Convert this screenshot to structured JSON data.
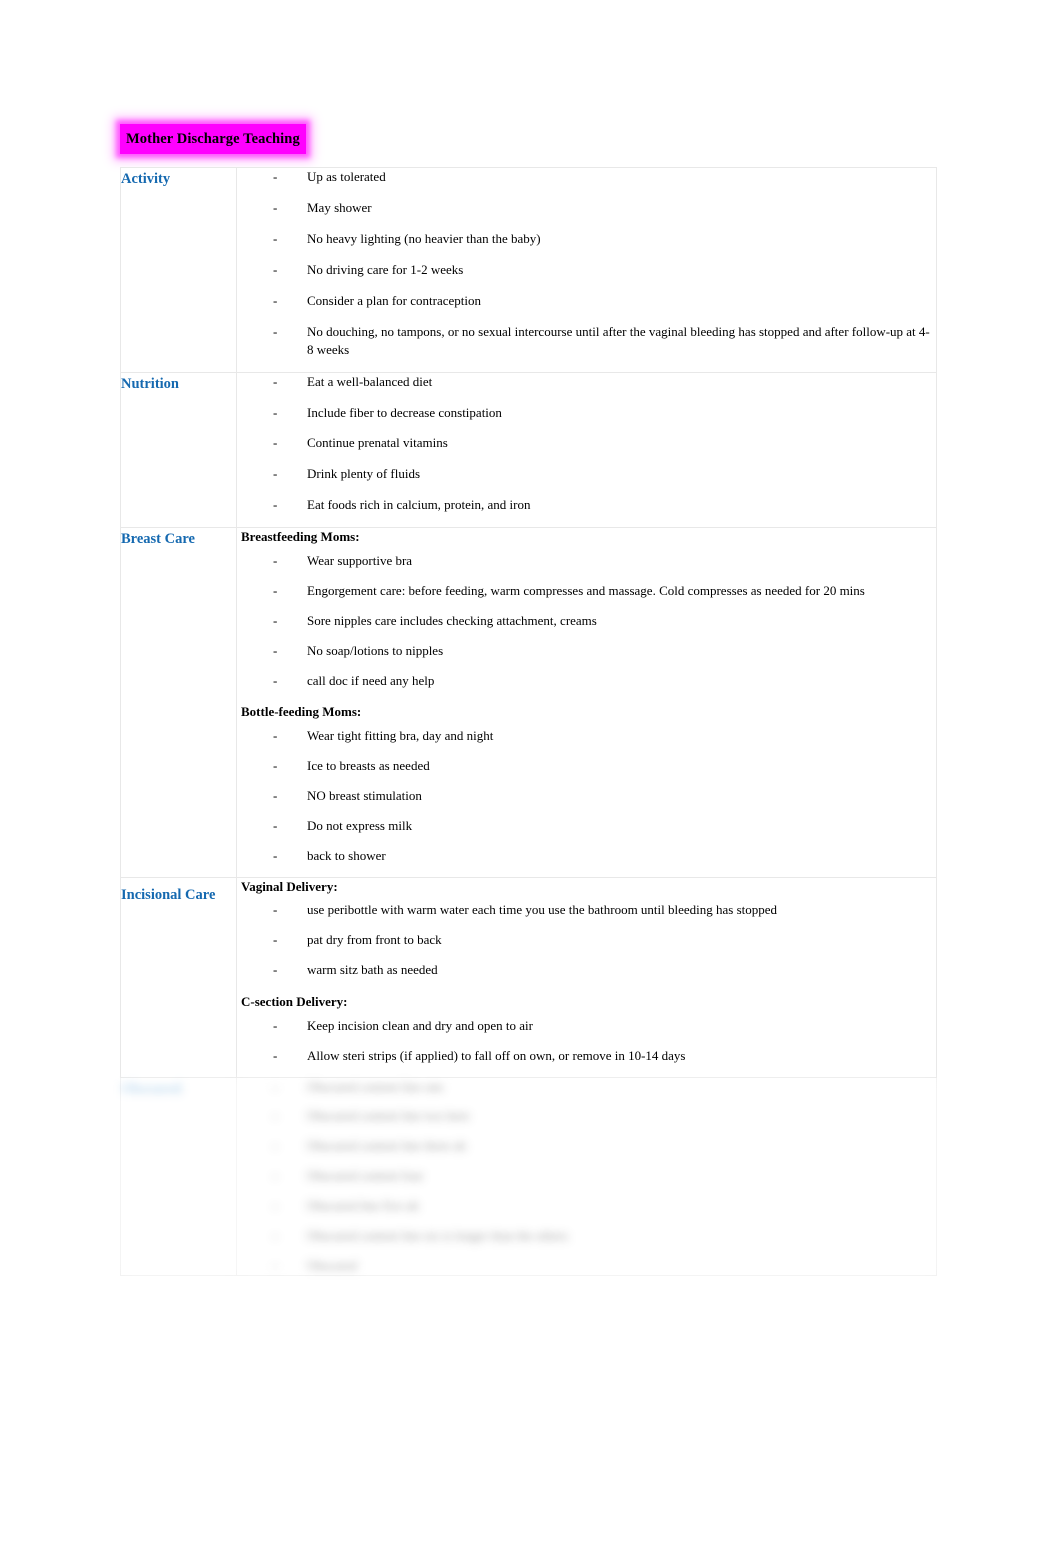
{
  "document": {
    "title": "Mother Discharge Teaching",
    "title_highlight_color": "#ff00ff",
    "heading_color": "#1569b0",
    "body_text_color": "#000000",
    "bullet_marker": "-"
  },
  "table": {
    "rows": [
      {
        "label": "Activity",
        "groups": [
          {
            "subhead": null,
            "items": [
              "Up as tolerated",
              "May shower",
              "No heavy lighting (no heavier than the baby)",
              "No driving care for 1-2 weeks",
              "Consider a plan for contraception",
              "No douching, no tampons, or no sexual intercourse until after the vaginal bleeding has stopped and after follow-up at 4-8 weeks"
            ]
          }
        ]
      },
      {
        "label": "Nutrition",
        "groups": [
          {
            "subhead": null,
            "items": [
              "Eat a well-balanced diet",
              "Include fiber to decrease constipation",
              "Continue prenatal vitamins",
              "Drink plenty of fluids",
              "Eat foods rich in calcium, protein, and iron"
            ]
          }
        ]
      },
      {
        "label": "Breast Care",
        "groups": [
          {
            "subhead": "Breastfeeding Moms:",
            "items": [
              "Wear supportive bra",
              "Engorgement care: before feeding, warm compresses and massage. Cold compresses as needed for 20 mins",
              "Sore nipples care includes checking attachment, creams",
              "No soap/lotions to nipples",
              "call doc if need any help"
            ]
          },
          {
            "subhead": "Bottle-feeding Moms:",
            "items": [
              "Wear tight fitting bra, day and night",
              "Ice to breasts as needed",
              "NO breast stimulation",
              "Do not express milk",
              "back to shower"
            ]
          }
        ]
      },
      {
        "label": "Incisional Care",
        "groups": [
          {
            "subhead": "Vaginal Delivery:",
            "items": [
              "use peribottle with warm water each time you use the bathroom until bleeding has stopped",
              "pat dry from front to back",
              "warm sitz bath as needed"
            ]
          },
          {
            "subhead": "C-section Delivery:",
            "items": [
              "Keep incision clean and dry and open to air",
              "Allow steri strips (if applied) to fall off on own, or remove in 10-14 days"
            ]
          }
        ]
      },
      {
        "label": "",
        "obscured": true,
        "groups": [
          {
            "subhead": null,
            "items": [
              "",
              "",
              "",
              "",
              "",
              "",
              ""
            ]
          }
        ]
      }
    ]
  }
}
